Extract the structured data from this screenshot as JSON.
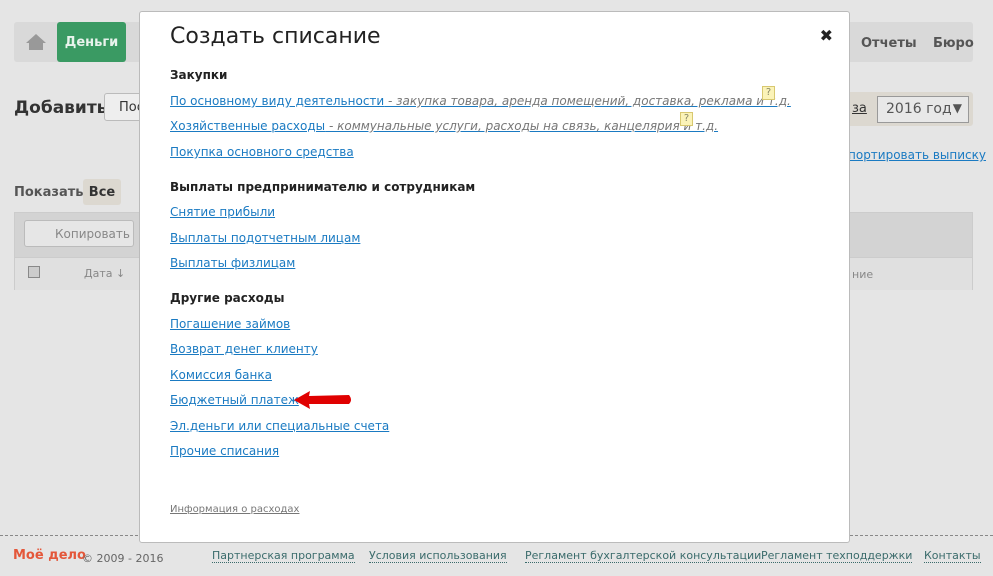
{
  "nav": {
    "money": "Деньги",
    "reports": "Отчеты",
    "bureau": "Бюро"
  },
  "page": {
    "add": "Добавить",
    "add_btn": "Пос",
    "show": "Показать:",
    "all": "Все",
    "year": "2016 год",
    "year_prefix": "за",
    "import_link": "портировать выписку",
    "copy": "Копировать",
    "col_date": "Дата ↓",
    "col_desc": "ние"
  },
  "modal": {
    "title": "Создать списание",
    "close": "✖",
    "sections": [
      {
        "title": "Закупки",
        "items": [
          {
            "label": "По основному виду деятельности",
            "desc": " - закупка товара, аренда помещений, доставка, реклама и т.д.",
            "help": "?"
          },
          {
            "label": "Хозяйственные расходы",
            "desc": " - коммунальные услуги, расходы на связь, канцелярия и т.д.",
            "help": "?"
          },
          {
            "label": "Покупка основного средства"
          }
        ]
      },
      {
        "title": "Выплаты предпринимателю и сотрудникам",
        "items": [
          {
            "label": "Снятие прибыли"
          },
          {
            "label": "Выплаты подотчетным лицам"
          },
          {
            "label": "Выплаты физлицам"
          }
        ]
      },
      {
        "title": "Другие расходы",
        "items": [
          {
            "label": "Погашение займов"
          },
          {
            "label": "Возврат денег клиенту"
          },
          {
            "label": "Комиссия банка"
          },
          {
            "label": "Бюджетный платеж"
          },
          {
            "label": "Эл.деньги или специальные счета"
          },
          {
            "label": "Прочие списания"
          }
        ]
      }
    ],
    "info": "Информация о расходах"
  },
  "footer": {
    "logo": "Моё дело",
    "copyright": "© 2009 - 2016",
    "links": [
      "Партнерская программа",
      "Условия использования",
      "Регламент бухгалтерской консультации",
      "Регламент техподдержки",
      "Контакты"
    ]
  },
  "colors": {
    "accent": "#3a9a63",
    "link": "#1a7ac2",
    "arrow": "#e00000"
  }
}
